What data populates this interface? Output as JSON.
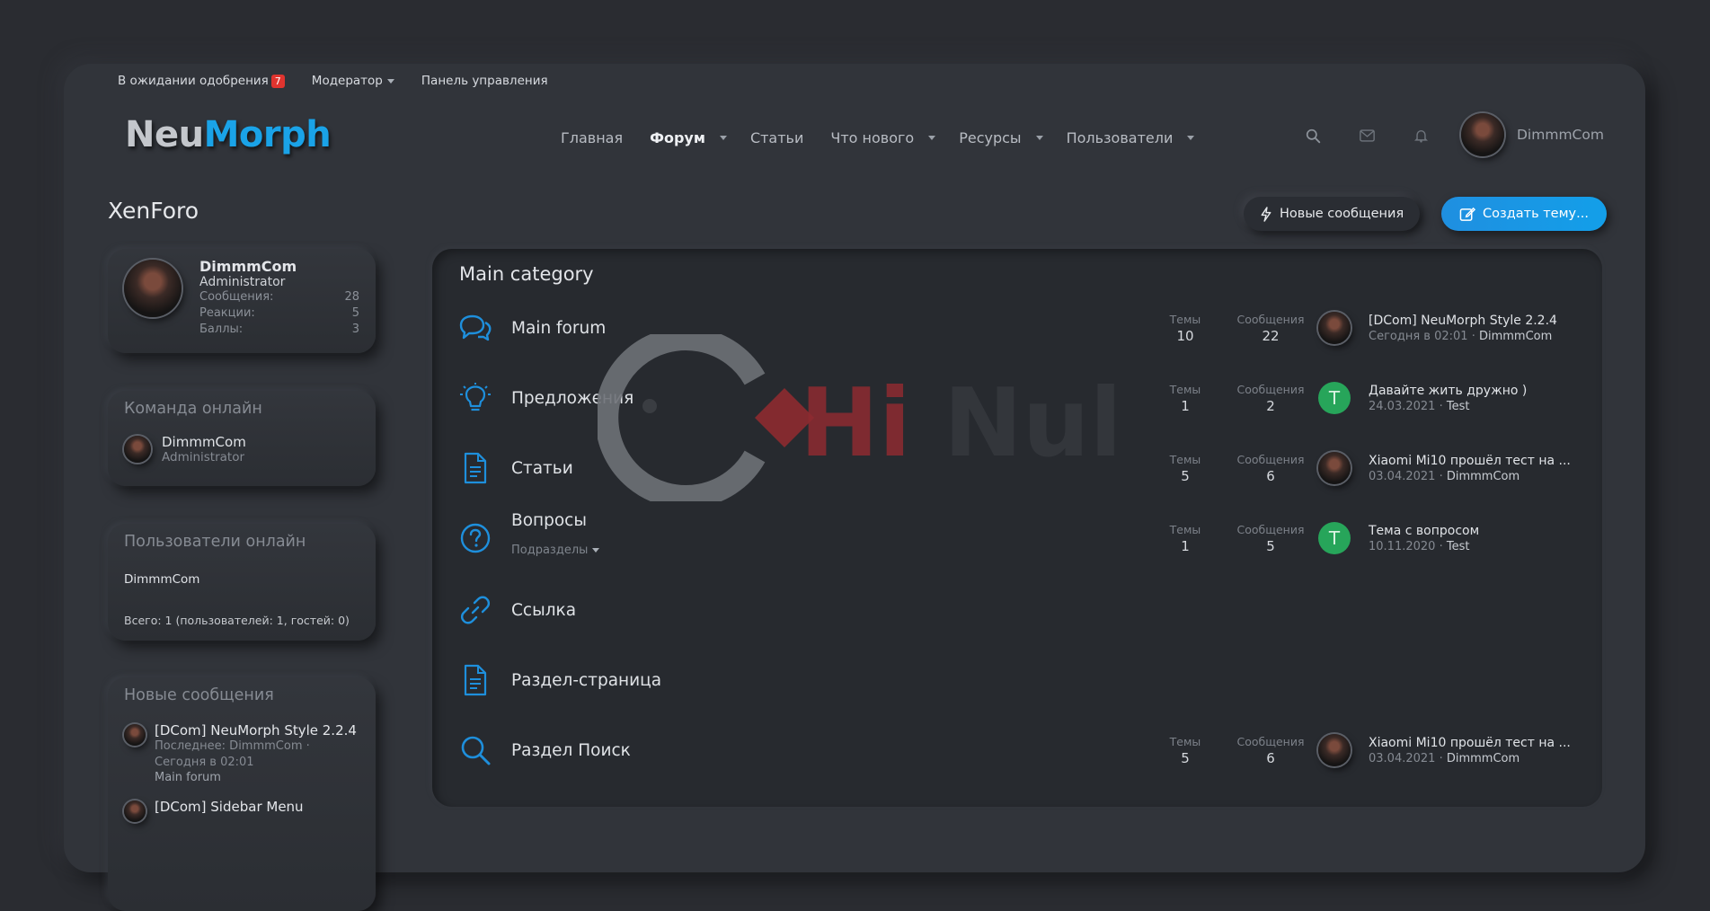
{
  "staffbar": {
    "approval_label": "В ожидании одобрения",
    "approval_count": "7",
    "moderator_label": "Модератор",
    "admin_label": "Панель управления"
  },
  "logo": {
    "part1": "Neu",
    "part2": "Morph"
  },
  "nav": {
    "home": "Главная",
    "forum": "Форум",
    "articles": "Статьи",
    "whats_new": "Что нового",
    "resources": "Ресурсы",
    "members": "Пользователи"
  },
  "header_icons": [
    "search-icon",
    "envelope-icon",
    "bell-icon"
  ],
  "user": {
    "name": "DimmmCom"
  },
  "page": {
    "title": "XenForo"
  },
  "buttons": {
    "new_posts": "Новые сообщения",
    "create_thread": "Создать тему..."
  },
  "sidebar": {
    "profile": {
      "name": "DimmmCom",
      "role": "Administrator",
      "stats": [
        {
          "label": "Сообщения:",
          "value": "28"
        },
        {
          "label": "Реакции:",
          "value": "5"
        },
        {
          "label": "Баллы:",
          "value": "3"
        }
      ]
    },
    "team": {
      "title": "Команда онлайн",
      "name": "DimmmCom",
      "role": "Administrator"
    },
    "online": {
      "title": "Пользователи онлайн",
      "name": "DimmmCom",
      "total": "Всего: 1 (пользователей: 1, гостей: 0)"
    },
    "new_posts": {
      "title": "Новые сообщения",
      "items": [
        {
          "title": "[DCom] NeuMorph Style 2.2.4",
          "meta1": "Последнее: DimmmCom ·",
          "meta2": "Сегодня в 02:01",
          "forum": "Main forum"
        },
        {
          "title": "[DCom] Sidebar Menu"
        }
      ]
    }
  },
  "category": {
    "title": "Main category",
    "labels": {
      "threads": "Темы",
      "messages": "Сообщения"
    },
    "nodes": [
      {
        "icon": "chat-bubbles-icon",
        "title": "Main forum",
        "threads": "10",
        "messages": "22",
        "last_title": "[DCom] NeuMorph Style 2.2.4",
        "last_date": "Сегодня в 02:01",
        "last_user": "DimmmCom",
        "avatar": "photo"
      },
      {
        "icon": "lightbulb-icon",
        "title": "Предложения",
        "threads": "1",
        "messages": "2",
        "last_title": "Давайте жить дружно )",
        "last_date": "24.03.2021",
        "last_user": "Test",
        "avatar": "T"
      },
      {
        "icon": "document-icon",
        "title": "Статьи",
        "threads": "5",
        "messages": "6",
        "last_title": "Xiaomi Mi10 прошёл тест на ...",
        "last_date": "03.04.2021",
        "last_user": "DimmmCom",
        "avatar": "photo"
      },
      {
        "icon": "question-circle-icon",
        "title": "Вопросы",
        "subforums": "Подразделы",
        "threads": "1",
        "messages": "5",
        "last_title": "Тема с вопросом",
        "last_date": "10.11.2020",
        "last_user": "Test",
        "avatar": "T"
      },
      {
        "icon": "link-icon",
        "title": "Ссылка"
      },
      {
        "icon": "document-icon",
        "title": "Раздел-страница"
      },
      {
        "icon": "search-icon",
        "title": "Раздел Поиск",
        "threads": "5",
        "messages": "6",
        "last_title": "Xiaomi Mi10 прошёл тест на ...",
        "last_date": "03.04.2021",
        "last_user": "DimmmCom",
        "avatar": "photo"
      }
    ]
  },
  "watermark": {
    "text1": "Hi",
    "text2": "Null"
  },
  "colors": {
    "accent": "#1aa3e8",
    "background": "#2a2c31",
    "panel": "#31343a",
    "badge": "#e0342f",
    "avatar_green": "#27a55a"
  }
}
